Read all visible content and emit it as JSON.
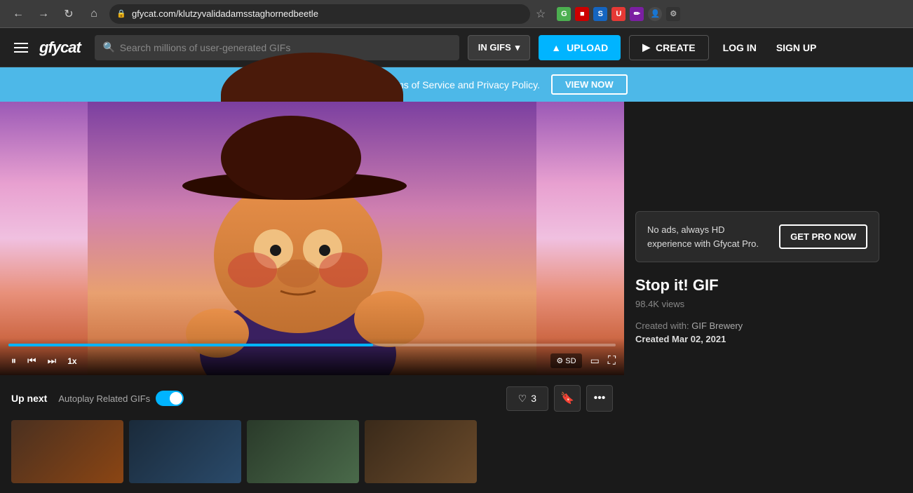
{
  "browser": {
    "back_label": "←",
    "forward_label": "→",
    "reload_label": "↺",
    "home_label": "⌂",
    "url": "gfycat.com/klutzyvalidadamsstaghornedbeetle",
    "star_label": "☆"
  },
  "navbar": {
    "menu_label": "☰",
    "logo_text": "gfycat",
    "search_placeholder": "Search millions of user-generated GIFs",
    "in_gifs_label": "IN GIFS",
    "upload_label": "UPLOAD",
    "create_label": "CREATE",
    "login_label": "LOG IN",
    "signup_label": "SIGN UP"
  },
  "tos_banner": {
    "text": "We have updated our Terms of Service and Privacy Policy.",
    "button_label": "VIEW NOW"
  },
  "video": {
    "speed_label": "1x",
    "sd_label": "SD",
    "progress_percent": 60
  },
  "below_player": {
    "up_next_label": "Up next",
    "autoplay_label": "Autoplay Related GIFs",
    "like_count": "3",
    "like_label": "♡ 3",
    "bookmark_label": "🔖",
    "more_label": "•••"
  },
  "sidebar": {
    "pro_banner_text": "No ads, always HD experience\nwith Gfycat Pro.",
    "get_pro_label": "GET PRO NOW",
    "gif_title": "Stop it! GIF",
    "gif_views": "98.4K views",
    "created_with_label": "Created with:",
    "created_with_value": "GIF Brewery",
    "created_date_label": "Created Mar 02, 2021"
  }
}
